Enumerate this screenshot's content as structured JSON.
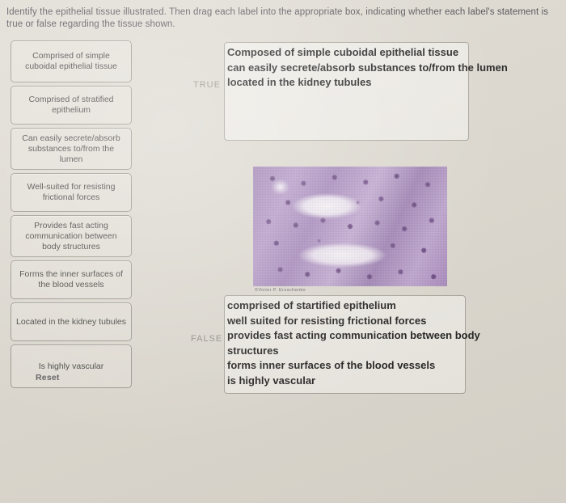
{
  "prompt": "Identify the epithelial tissue illustrated.  Then drag each label into the appropriate box, indicating whether each label's statement is true or false regarding the tissue shown.",
  "label_bank": {
    "items": [
      {
        "text": "Comprised of simple cuboidal epithelial tissue"
      },
      {
        "text": "Comprised of stratified epithelium"
      },
      {
        "text": "Can easily secrete/absorb substances to/from the lumen"
      },
      {
        "text": "Well-suited for resisting frictional forces"
      },
      {
        "text": "Provides fast acting communication between body structures"
      },
      {
        "text": "Forms the inner surfaces of the blood vessels"
      },
      {
        "text": "Located in the kidney tubules"
      },
      {
        "text": "Is highly vascular"
      }
    ],
    "reset_label": "Reset"
  },
  "drop_zones": {
    "true": {
      "tag": "TRUE",
      "answers": [
        "Composed of simple cuboidal epithelial tissue",
        "can easily secrete/absorb substances to/from the lumen",
        "located in the kidney tubules"
      ]
    },
    "false": {
      "tag": "FALSE",
      "answers": [
        "comprised of startified epithelium",
        "well suited for resisting frictional forces",
        "provides fast acting communication between body structures",
        "forms inner surfaces of the blood vessels",
        "is highly vascular"
      ]
    }
  },
  "micrograph": {
    "caption": "©Victor P. Eroschenko",
    "alt_name": "kidney-tubules-histology"
  },
  "colors": {
    "page_background": "#dedad1",
    "label_fill": "#e4e0d8",
    "label_border": "#9a968e",
    "dropbox_border": "#a8a49c",
    "answer_text": "#1a1a1a",
    "zone_tag_text": "#8e8b86",
    "prompt_text": "#4d4a52",
    "stain_purple": "#a383bb",
    "nucleus_purple": "#4b2a63"
  }
}
